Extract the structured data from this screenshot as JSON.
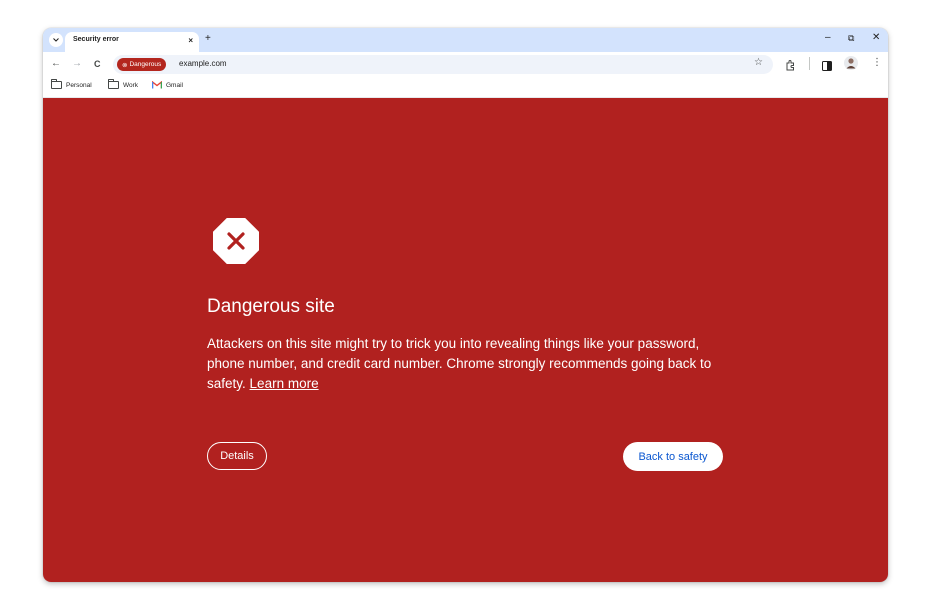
{
  "tab": {
    "title": "Security error",
    "close": "×",
    "new_tab": "+"
  },
  "window_controls": {
    "minimize": "–",
    "restore": "⧉",
    "close": "✕"
  },
  "toolbar": {
    "back": "←",
    "forward": "→",
    "reload": "C",
    "chip_label": "Dangerous",
    "chip_icon": "⊗",
    "url": "example.com",
    "star": "☆",
    "menu": "⋮"
  },
  "bookmarks": [
    {
      "label": "Personal",
      "icon": "folder-icon"
    },
    {
      "label": "Work",
      "icon": "folder-icon"
    },
    {
      "label": "Gmail",
      "icon": "gmail-icon"
    }
  ],
  "interstitial": {
    "heading": "Dangerous site",
    "message": "Attackers on this site might try to trick you into revealing things like your password, phone number, and credit card number. Chrome strongly recommends going back to safety.",
    "learn_more": "Learn more",
    "details_button": "Details",
    "safety_button": "Back to safety"
  },
  "colors": {
    "danger_bg": "#b1211f",
    "tabstrip": "#d3e3fd",
    "link_blue": "#0b57d0"
  }
}
